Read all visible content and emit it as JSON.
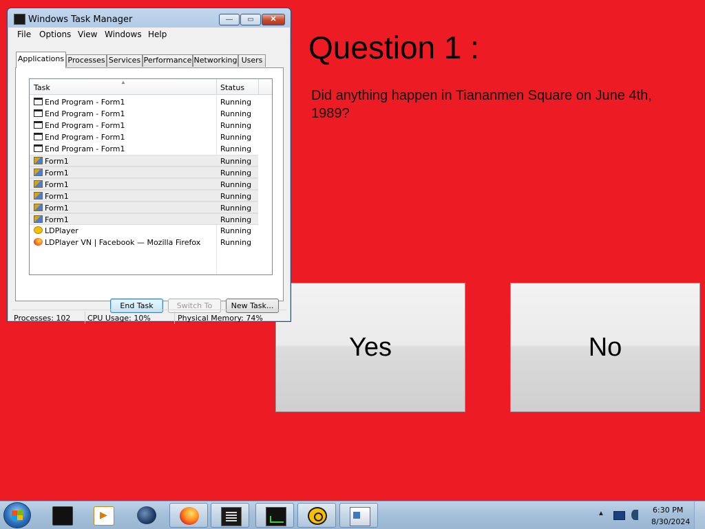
{
  "quiz": {
    "heading": "Question 1 :",
    "question": "Did anything happen in Tiananmen Square on June 4th, 1989?",
    "yes_label": "Yes",
    "no_label": "No",
    "background_color": "#ed1c24"
  },
  "task_manager": {
    "title": "Windows Task Manager",
    "window_controls": {
      "minimize": "—",
      "maximize": "▭",
      "close": "✕"
    },
    "menu": [
      "File",
      "Options",
      "View",
      "Windows",
      "Help"
    ],
    "tabs": [
      "Applications",
      "Processes",
      "Services",
      "Performance",
      "Networking",
      "Users"
    ],
    "active_tab": "Applications",
    "columns": {
      "task": "Task",
      "status": "Status"
    },
    "rows": [
      {
        "task": "End Program - Form1",
        "status": "Running",
        "icon": "window-icon"
      },
      {
        "task": "End Program - Form1",
        "status": "Running",
        "icon": "window-icon"
      },
      {
        "task": "End Program - Form1",
        "status": "Running",
        "icon": "window-icon"
      },
      {
        "task": "End Program - Form1",
        "status": "Running",
        "icon": "window-icon"
      },
      {
        "task": "End Program - Form1",
        "status": "Running",
        "icon": "window-icon"
      },
      {
        "task": "Form1",
        "status": "Running",
        "icon": "form-icon"
      },
      {
        "task": "Form1",
        "status": "Running",
        "icon": "form-icon"
      },
      {
        "task": "Form1",
        "status": "Running",
        "icon": "form-icon"
      },
      {
        "task": "Form1",
        "status": "Running",
        "icon": "form-icon"
      },
      {
        "task": "Form1",
        "status": "Running",
        "icon": "form-icon"
      },
      {
        "task": "Form1",
        "status": "Running",
        "icon": "form-icon"
      },
      {
        "task": "LDPlayer",
        "status": "Running",
        "icon": "ldplayer-icon"
      },
      {
        "task": "LDPlayer VN | Facebook — Mozilla Firefox",
        "status": "Running",
        "icon": "firefox-icon"
      }
    ],
    "buttons": {
      "end_task": "End Task",
      "switch_to": "Switch To",
      "new_task": "New Task..."
    },
    "status_bar": {
      "processes": "Processes: 102",
      "cpu": "CPU Usage: 10%",
      "memory": "Physical Memory: 74%"
    }
  },
  "taskbar": {
    "pinned": [
      "terminal-icon",
      "media-player-icon",
      "globe-app-icon",
      "firefox-icon",
      "list-app-icon",
      "task-manager-icon",
      "ldplayer-icon",
      "form-app-icon"
    ],
    "clock_time": "6:30 PM",
    "clock_date": "8/30/2024",
    "tray_expand": "▲"
  }
}
